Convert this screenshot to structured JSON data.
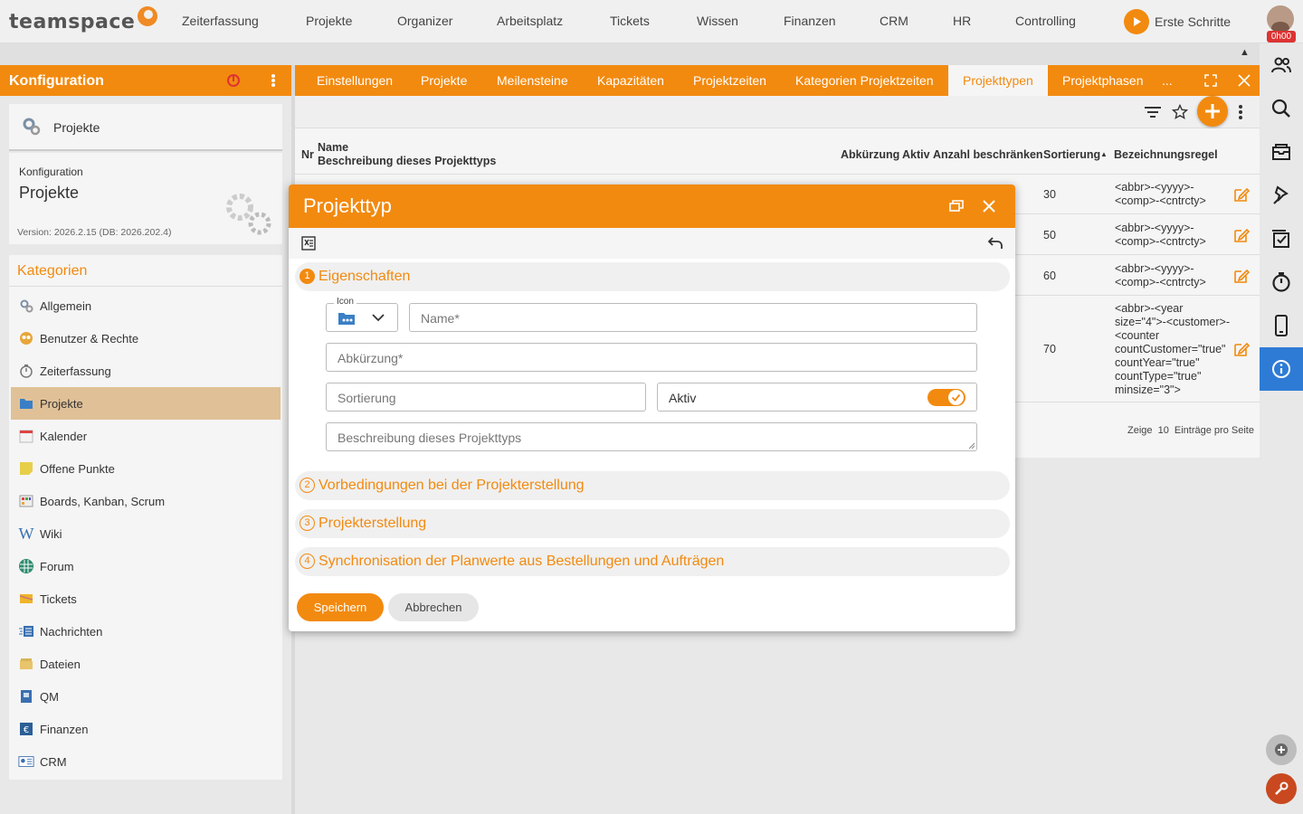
{
  "app": {
    "logo_text": "teamspace",
    "brand_color": "#f28a0f"
  },
  "topnav": {
    "items": [
      {
        "label": "Zeiterfassung"
      },
      {
        "label": "Projekte"
      },
      {
        "label": "Organizer"
      },
      {
        "label": "Arbeitsplatz"
      },
      {
        "label": "Tickets"
      },
      {
        "label": "Wissen"
      },
      {
        "label": "Finanzen"
      },
      {
        "label": "CRM"
      },
      {
        "label": "HR"
      },
      {
        "label": "Controlling"
      }
    ],
    "erste_schritte": "Erste Schritte",
    "timer": "0h00",
    "collapse_glyph": "▲"
  },
  "left_panel": {
    "header_title": "Konfiguration",
    "project_card_label": "Projekte",
    "konf_label": "Konfiguration",
    "konf_title": "Projekte",
    "version": "Version: 2026.2.15 (DB: 2026.202.4)",
    "categories_title": "Kategorien",
    "categories": [
      {
        "label": "Allgemein",
        "icon": "gears-icon"
      },
      {
        "label": "Benutzer & Rechte",
        "icon": "users-icon"
      },
      {
        "label": "Zeiterfassung",
        "icon": "stopwatch-icon"
      },
      {
        "label": "Projekte",
        "icon": "folder-icon",
        "selected": true
      },
      {
        "label": "Kalender",
        "icon": "calendar-icon"
      },
      {
        "label": "Offene Punkte",
        "icon": "sticky-note-icon"
      },
      {
        "label": "Boards, Kanban, Scrum",
        "icon": "board-icon"
      },
      {
        "label": "Wiki",
        "icon": "wiki-icon"
      },
      {
        "label": "Forum",
        "icon": "forum-icon"
      },
      {
        "label": "Tickets",
        "icon": "ticket-icon"
      },
      {
        "label": "Nachrichten",
        "icon": "messages-icon"
      },
      {
        "label": "Dateien",
        "icon": "files-icon"
      },
      {
        "label": "QM",
        "icon": "qm-icon"
      },
      {
        "label": "Finanzen",
        "icon": "euro-icon"
      },
      {
        "label": "CRM",
        "icon": "crm-icon"
      }
    ]
  },
  "tabs": {
    "items": [
      {
        "label": "Einstellungen"
      },
      {
        "label": "Projekte"
      },
      {
        "label": "Meilensteine"
      },
      {
        "label": "Kapazitäten"
      },
      {
        "label": "Projektzeiten"
      },
      {
        "label": "Kategorien Projektzeiten"
      },
      {
        "label": "Projekttypen",
        "active": true
      },
      {
        "label": "Projektphasen"
      }
    ],
    "more": "..."
  },
  "table": {
    "headers": {
      "nr": "Nr",
      "name": "Name",
      "desc": "Beschreibung dieses Projekttyps",
      "abbr": "Abkürzung",
      "aktiv": "Aktiv",
      "anzahl": "Anzahl beschränken",
      "sort": "Sortierung",
      "sort_arrow": "▲",
      "rule": "Bezeichnungsregel"
    },
    "rows": [
      {
        "sort": "30",
        "rule": "<abbr>-<yyyy>-<comp>-<cntrcty>"
      },
      {
        "sort": "50",
        "rule": "<abbr>-<yyyy>-<comp>-<cntrcty>"
      },
      {
        "sort": "60",
        "rule": "<abbr>-<yyyy>-<comp>-<cntrcty>"
      },
      {
        "sort": "70",
        "rule": "<abbr>-<year size=\"4\">-<customer>-<counter countCustomer=\"true\" countYear=\"true\" countType=\"true\" minsize=\"3\">"
      }
    ],
    "footer_prefix": "Zeige",
    "page_size": "10",
    "footer_suffix": "Einträge pro Seite"
  },
  "modal": {
    "title": "Projekttyp",
    "sections": [
      {
        "num": "1",
        "title": "Eigenschaften",
        "open": true
      },
      {
        "num": "2",
        "title": "Vorbedingungen bei der Projekterstellung"
      },
      {
        "num": "3",
        "title": "Projekterstellung"
      },
      {
        "num": "4",
        "title": "Synchronisation der Planwerte aus Bestellungen und Aufträgen"
      }
    ],
    "icon_legend": "Icon",
    "name_placeholder": "Name*",
    "abbr_placeholder": "Abkürzung*",
    "sort_placeholder": "Sortierung",
    "aktiv_label": "Aktiv",
    "aktiv_value": true,
    "desc_placeholder": "Beschreibung dieses Projekttyps",
    "save_label": "Speichern",
    "cancel_label": "Abbrechen"
  }
}
